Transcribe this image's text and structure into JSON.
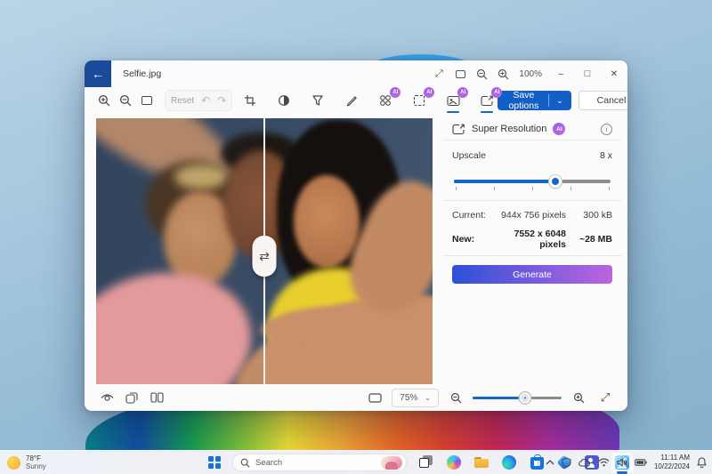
{
  "colors": {
    "accent_blue": "#1466c8",
    "save_button_blue": "#1260c6",
    "back_button_blue": "#1a4a99",
    "ai_badge_gradient": [
      "#9b5fe8",
      "#c168de"
    ],
    "generate_gradient": [
      "#2b50d8",
      "#bb64dd"
    ],
    "sky_blue": "#a4c6dd"
  },
  "icons": {
    "back": "←",
    "expand": "⤢",
    "minimize": "–",
    "maximize": "□",
    "close": "✕",
    "undo": "↶",
    "redo": "↷",
    "chevron_down": "⌄",
    "chevron_up": "∧",
    "swap": "⇄",
    "info": "i"
  },
  "window": {
    "title": "Selfie.jpg",
    "zoom_level": "100%"
  },
  "toolbar": {
    "reset": "Reset",
    "ai_badge": "AI",
    "save_options": "Save options",
    "cancel": "Cancel"
  },
  "panel": {
    "title": "Super Resolution",
    "ai_badge": "AI",
    "upscale_label": "Upscale",
    "upscale_value": "8 x",
    "slider_percent": 65,
    "rows": [
      {
        "label": "Current:",
        "size": "944x 756 pixels",
        "filesize": "300 kB"
      },
      {
        "label": "New:",
        "size": "7552 x 6048 pixels",
        "filesize": "~28 MB"
      }
    ],
    "generate": "Generate"
  },
  "statusbar": {
    "zoom_value": "75%",
    "zoom_slider_percent": 59
  },
  "taskbar": {
    "search_placeholder": "Search",
    "time": "11:11 AM",
    "date": "10/22/2024"
  },
  "desktop": {
    "weather_temp": "78°F",
    "weather_condition": "Sunny"
  }
}
